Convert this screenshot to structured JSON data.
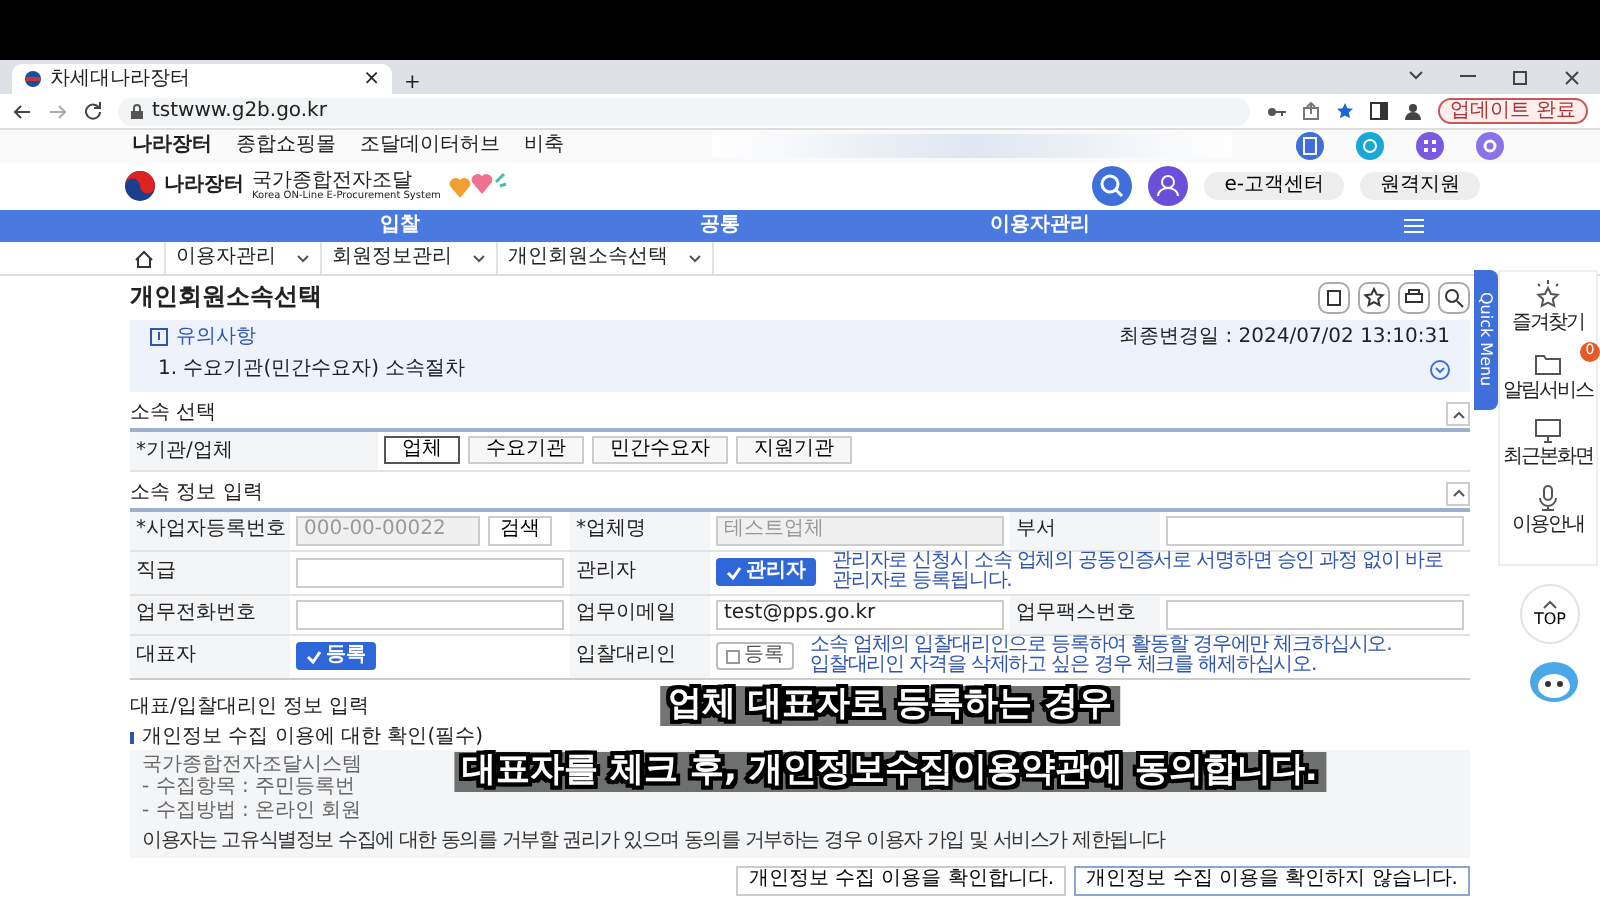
{
  "browser": {
    "tab_title": "차세대나라장터",
    "tab_close": "×",
    "new_tab": "+",
    "url": "tstwww.g2b.go.kr",
    "profile_button": "업데이트 완료"
  },
  "top_links": [
    "나라장터",
    "종합쇼핑몰",
    "조달데이터허브",
    "비축"
  ],
  "header": {
    "logo_title": "나라장터",
    "logo_sub": "국가종합전자조달",
    "logo_en": "Korea ON-Line E-Procurement System",
    "buttons": [
      "e-고객센터",
      "원격지원"
    ]
  },
  "nav": [
    "입찰",
    "공통",
    "이용자관리"
  ],
  "breadcrumb": [
    "이용자관리",
    "회원정보관리",
    "개인회원소속선택"
  ],
  "page_title": "개인회원소속선택",
  "notice": {
    "title": "유의사항",
    "updated": "최종변경일 : 2024/07/02 13:10:31",
    "items": [
      "1. 수요기관(민간수요자) 소속절차"
    ]
  },
  "affiliation": {
    "title": "소속 선택",
    "label": "*기관/업체",
    "options": [
      {
        "label": "업체",
        "selected": true
      },
      {
        "label": "수요기관",
        "selected": false
      },
      {
        "label": "민간수요자",
        "selected": false
      },
      {
        "label": "지원기관",
        "selected": false
      }
    ]
  },
  "info": {
    "title": "소속 정보 입력",
    "rows": [
      [
        {
          "kind": "label",
          "text": "*사업자등록번호"
        },
        {
          "kind": "input",
          "placeholder": "000-00-00022",
          "disabled": true,
          "button": "검색"
        },
        {
          "kind": "label",
          "text": "*업체명"
        },
        {
          "kind": "input",
          "placeholder": "테스트업체",
          "disabled": true
        },
        {
          "kind": "label",
          "text": "부서"
        },
        {
          "kind": "input",
          "disabled": false
        }
      ],
      [
        {
          "kind": "label",
          "text": "직급"
        },
        {
          "kind": "input",
          "disabled": false
        },
        {
          "kind": "label",
          "text": "관리자"
        },
        {
          "kind": "check",
          "label": "관리자",
          "checked": true,
          "notes": [
            "관리자로 신청시 소속 업체의 공동인증서로 서명하면 승인 과정 없이 바로 관리자로 등록됩니다."
          ]
        }
      ],
      [
        {
          "kind": "label",
          "text": "업무전화번호"
        },
        {
          "kind": "input",
          "disabled": false
        },
        {
          "kind": "label",
          "text": "업무이메일"
        },
        {
          "kind": "input",
          "value": "test@pps.go.kr",
          "disabled": false
        },
        {
          "kind": "label",
          "text": "업무팩스번호"
        },
        {
          "kind": "input",
          "disabled": false
        }
      ],
      [
        {
          "kind": "label",
          "text": "대표자"
        },
        {
          "kind": "check",
          "label": "등록",
          "checked": true
        },
        {
          "kind": "label",
          "text": "입찰대리인"
        },
        {
          "kind": "check",
          "label": "등록",
          "checked": false,
          "notes": [
            "소속 업체의 입찰대리인으로 등록하여 활동할 경우에만 체크하십시오.",
            "입찰대리인 자격을 삭제하고 싶은 경우 체크를 해제하십시오."
          ]
        }
      ]
    ]
  },
  "consent": {
    "title": "대표/입찰대리인 정보 입력",
    "subtitle": "개인정보 수집 이용에 대한 확인(필수)",
    "lines": [
      "국가종합전자조달시스템",
      "- 수집항목 : 주민등록번",
      "- 수집방법 : 온라인 회원"
    ],
    "warning": "이용자는 고유식별정보 수집에 대한 동의를 거부할 권리가 있으며 동의를 거부하는 경우 이용자 가입 및 서비스가 제한됩니다",
    "buttons": [
      {
        "label": "개인정보 수집 이용을 확인합니다.",
        "selected": false
      },
      {
        "label": "개인정보 수집 이용을 확인하지 않습니다.",
        "selected": true
      }
    ]
  },
  "quick_menu": {
    "tab": "Quick Menu",
    "items": [
      {
        "kind": "star",
        "label": "즐겨찾기"
      },
      {
        "kind": "folder",
        "label": "알림서비스",
        "badge": "0"
      },
      {
        "kind": "monitor",
        "label": "최근본화면"
      },
      {
        "kind": "mic",
        "label": "이용안내"
      }
    ],
    "top": "TOP"
  },
  "subtitles": [
    "업체 대표자로 등록하는 경우",
    "대표자를 체크 후, 개인정보수집이용약관에 동의합니다."
  ]
}
